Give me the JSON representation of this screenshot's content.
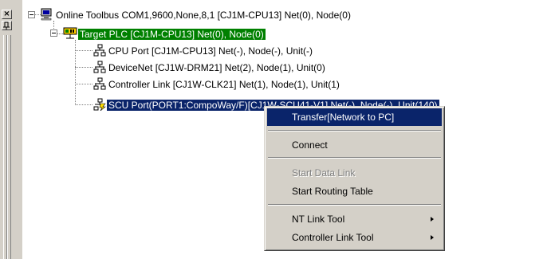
{
  "tree": {
    "root": {
      "label": "Online Toolbus COM1,9600,None,8,1 [CJ1M-CPU13] Net(0), Node(0)",
      "icon": "pc-monitor-icon"
    },
    "plc": {
      "label": "Target PLC [CJ1M-CPU13] Net(0), Node(0)",
      "icon": "plc-icon",
      "highlight_color": "#008000"
    },
    "children": [
      {
        "label": "CPU Port [CJ1M-CPU13] Net(-), Node(-), Unit(-)",
        "icon": "network-port-icon"
      },
      {
        "label": "DeviceNet [CJ1W-DRM21] Net(2), Node(1), Unit(0)",
        "icon": "network-port-icon"
      },
      {
        "label": "Controller Link [CJ1W-CLK21] Net(1), Node(1), Unit(1)",
        "icon": "network-port-icon"
      },
      {
        "label": "SCU Port(PORT1:CompoWay/F)[CJ1W-SCU41-V1] Net(-), Node(-), Unit(140)",
        "icon": "scu-port-icon",
        "selected": true
      }
    ]
  },
  "context_menu": {
    "items": [
      {
        "label": "Transfer[Network to PC]",
        "highlighted": true
      },
      {
        "label": "Connect"
      },
      {
        "label": "Start Data Link",
        "disabled": true
      },
      {
        "label": "Start Routing Table"
      },
      {
        "label": "NT Link Tool",
        "submenu": true
      },
      {
        "label": "Controller Link Tool",
        "submenu": true
      }
    ]
  },
  "colors": {
    "selection_blue": "#0a246a",
    "plc_green": "#008000",
    "face": "#d4d0c8"
  }
}
